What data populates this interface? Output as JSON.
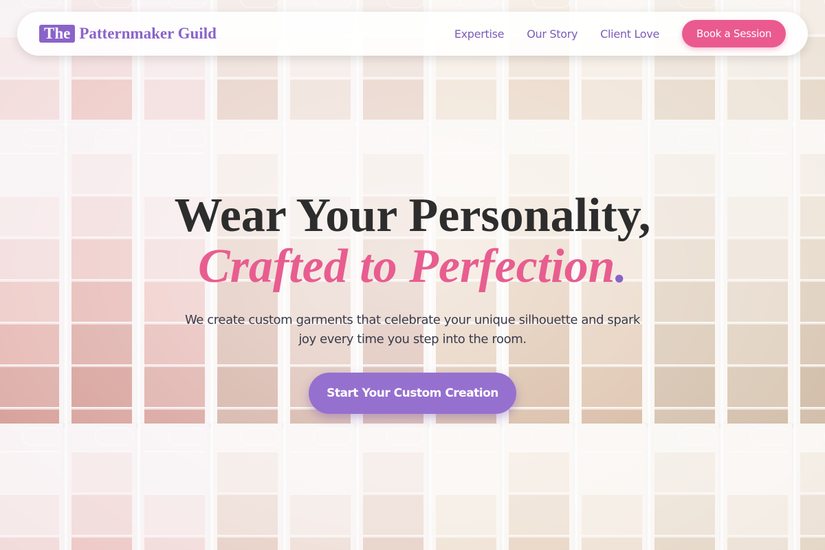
{
  "brand": {
    "prefix": "The",
    "name": "Patternmaker Guild"
  },
  "nav": {
    "links": [
      "Expertise",
      "Our Story",
      "Client Love"
    ],
    "cta": "Book a Session"
  },
  "hero": {
    "line1": "Wear Your Personality,",
    "line2": "Crafted to Perfection",
    "line2_dot": ".",
    "subtitle": "We create custom garments that celebrate your unique silhouette and spark joy every time you step into the room.",
    "cta": "Start Your Custom Creation"
  },
  "colors": {
    "accent_purple": "#8a63c9",
    "accent_pink": "#ea5a8f",
    "heading": "#2d2d2d"
  }
}
